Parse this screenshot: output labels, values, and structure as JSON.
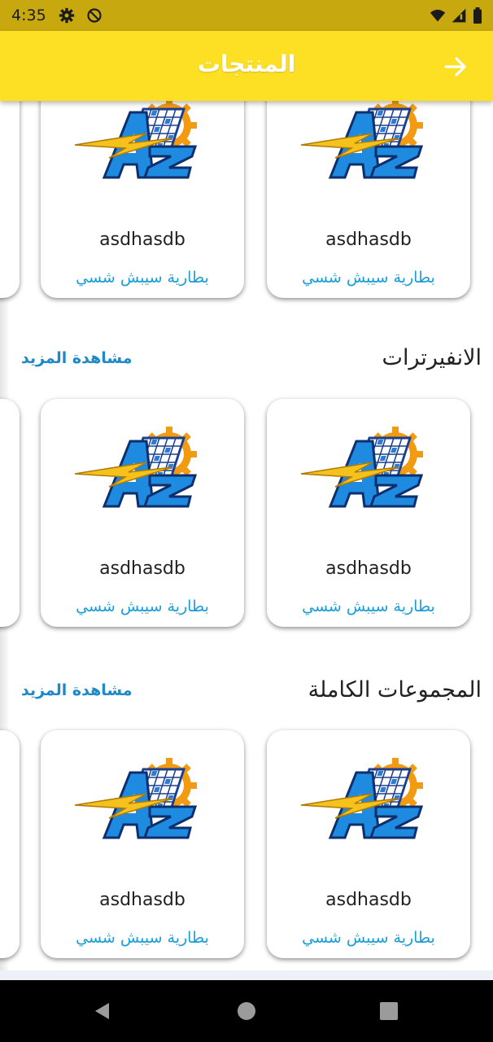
{
  "status_bar": {
    "time": "4:35",
    "icons": [
      "gear-icon",
      "do-not-disturb-icon",
      "wifi-icon",
      "signal-icon",
      "battery-icon"
    ]
  },
  "app_bar": {
    "title": "المنتجات",
    "back_icon": "arrow-right-icon",
    "background_color": "#fde024"
  },
  "sections": [
    {
      "title": "",
      "see_more": "",
      "products": [
        {
          "name": "asdhasdb",
          "category": "بطارية سيبش شسي"
        },
        {
          "name": "asdhasdb",
          "category": "بطارية سيبش شسي"
        }
      ]
    },
    {
      "title": "الانفيرترات",
      "see_more": "مشاهدة المزيد",
      "products": [
        {
          "name": "asdhasdb",
          "category": "بطارية سيبش شسي"
        },
        {
          "name": "asdhasdb",
          "category": "بطارية سيبش شسي"
        }
      ]
    },
    {
      "title": "المجموعات الكاملة",
      "see_more": "مشاهدة المزيد",
      "products": [
        {
          "name": "asdhasdb",
          "category": "بطارية سيبش شسي"
        },
        {
          "name": "asdhasdb",
          "category": "بطارية سيبش شسي"
        }
      ]
    }
  ],
  "colors": {
    "accent": "#1e88c8",
    "category_text": "#1a9ed8",
    "status_bar": "#c8a80f"
  },
  "nav_bar": {
    "icons": [
      "back-triangle-icon",
      "home-circle-icon",
      "recents-square-icon"
    ]
  }
}
